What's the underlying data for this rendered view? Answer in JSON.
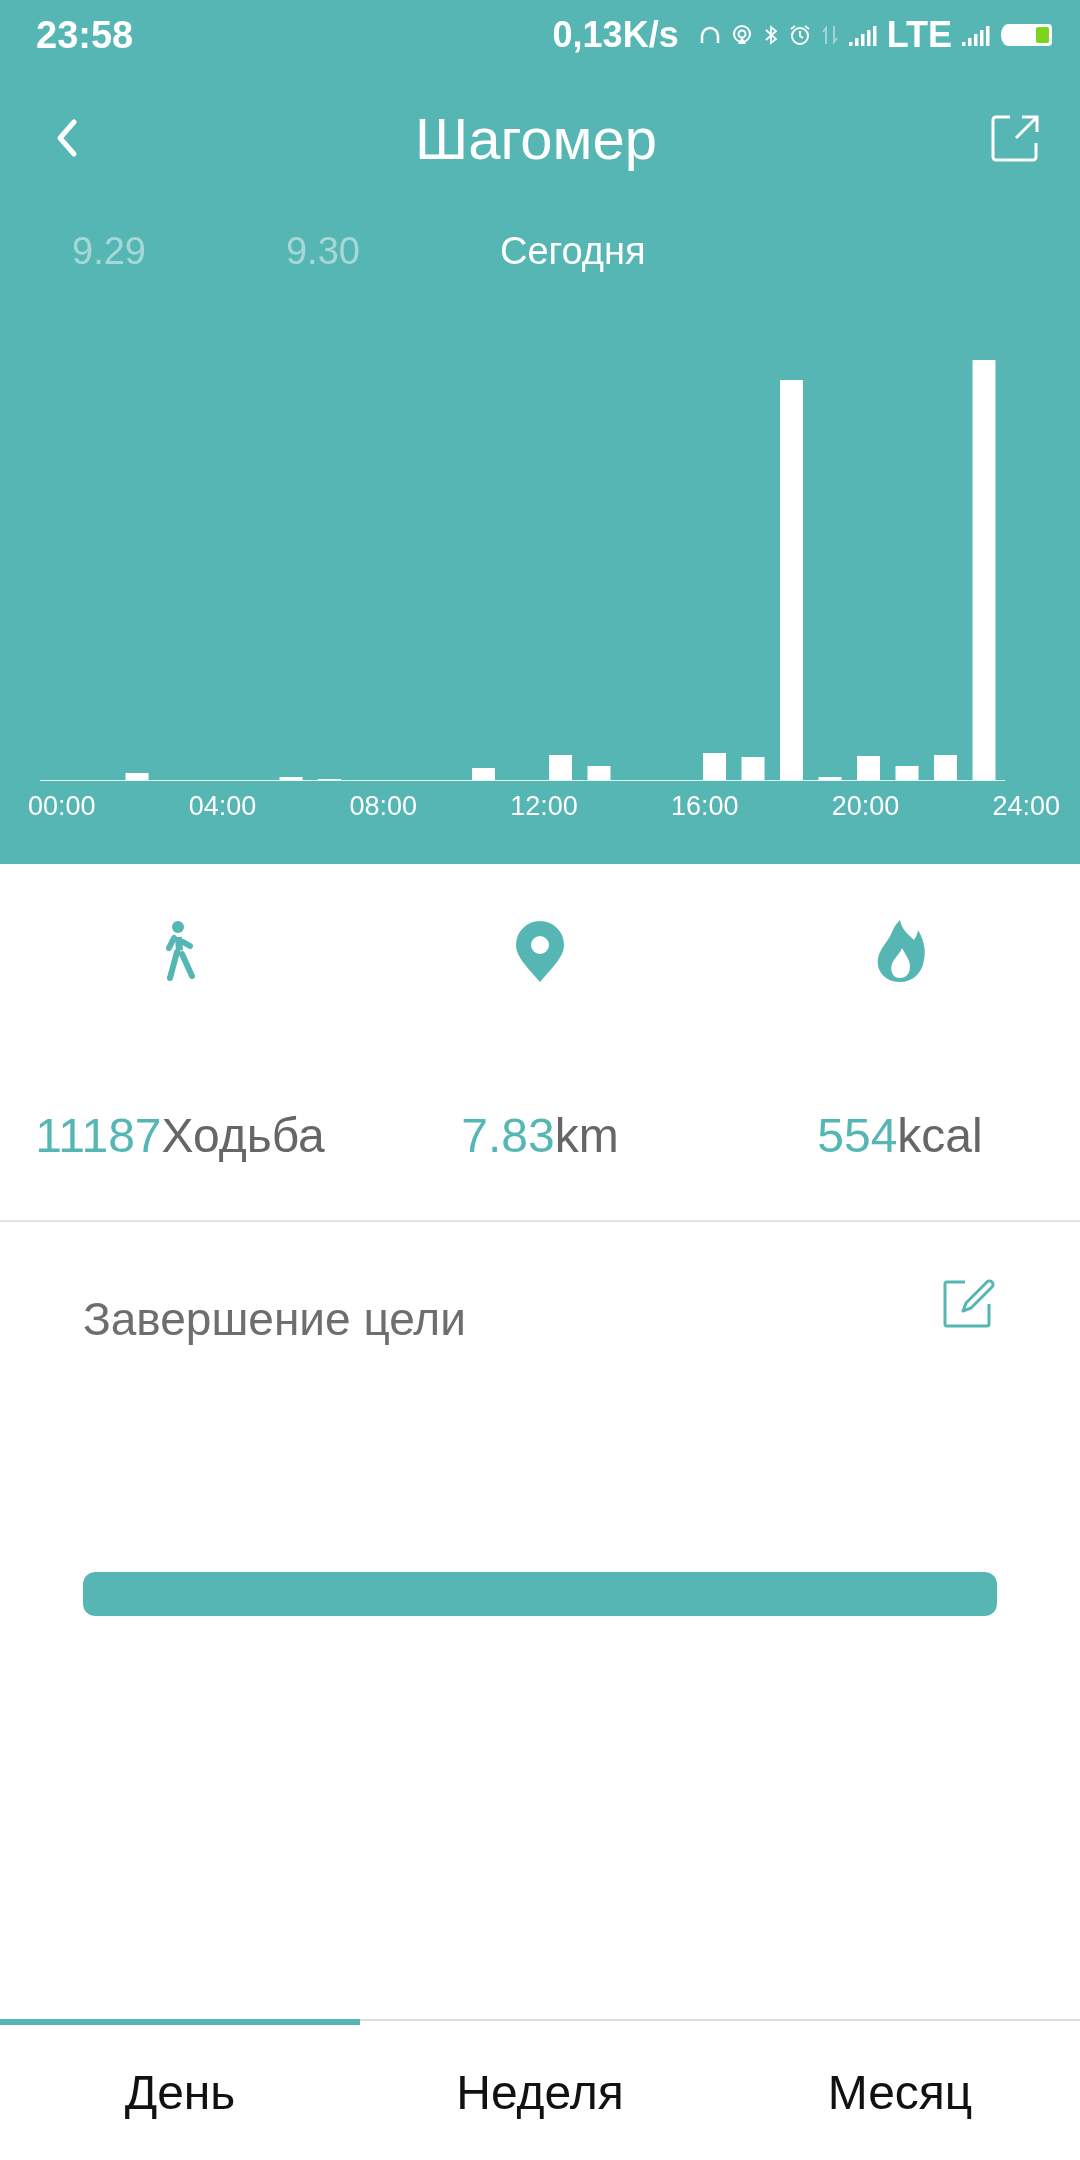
{
  "status_bar": {
    "time": "23:58",
    "speed": "0,13K/s",
    "network": "LTE"
  },
  "header": {
    "title": "Шагомер"
  },
  "date_tabs": [
    {
      "label": "9.29",
      "selected": false
    },
    {
      "label": "9.30",
      "selected": false
    },
    {
      "label": "Сегодня",
      "selected": true
    }
  ],
  "chart": {
    "x_labels": [
      "00:00",
      "04:00",
      "08:00",
      "12:00",
      "16:00",
      "20:00",
      "24:00"
    ]
  },
  "stats": [
    {
      "kind": "steps",
      "value": "11187",
      "unit": "Ходьба"
    },
    {
      "kind": "distance",
      "value": "7.83",
      "unit": "km"
    },
    {
      "kind": "calories",
      "value": "554",
      "unit": "kcal"
    }
  ],
  "goal": {
    "title": "Завершение цели",
    "level": 1
  },
  "bottom_tabs": [
    {
      "label": "День",
      "selected": true
    },
    {
      "label": "Неделя",
      "selected": false
    },
    {
      "label": "Месяц",
      "selected": false
    }
  ]
}
